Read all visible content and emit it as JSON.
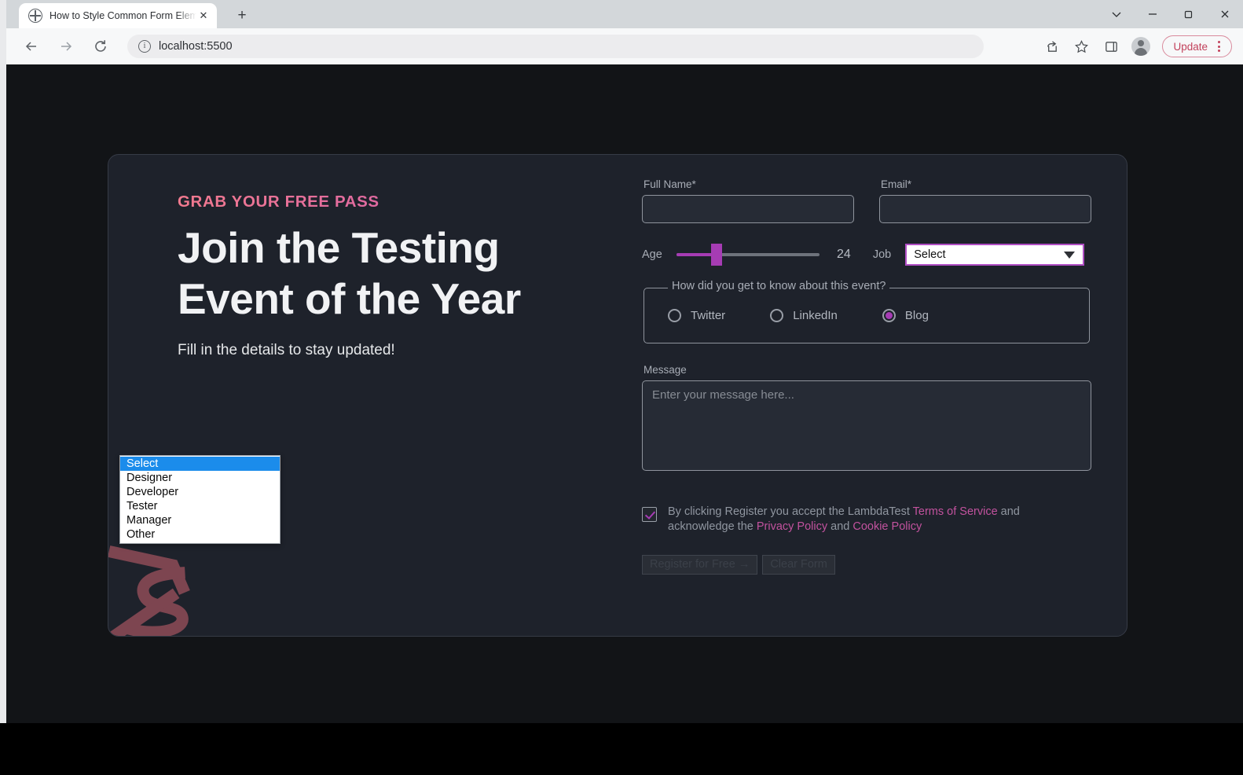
{
  "browser": {
    "tab": {
      "title": "How to Style Common Form Elem",
      "favicon": "globe-icon",
      "close_label": "✕"
    },
    "new_tab_label": "+",
    "window_controls": {
      "chevron": "chevron-down-icon",
      "minimize": "minimize-icon",
      "maximize": "maximize-icon",
      "close": "close-icon"
    },
    "toolbar": {
      "back": "back-arrow-icon",
      "forward": "forward-arrow-icon",
      "reload": "reload-icon",
      "site_info": "info-icon",
      "url": "localhost:5500",
      "share": "share-icon",
      "bookmark": "star-icon",
      "side_panel": "side-panel-icon",
      "profile": "avatar-icon",
      "update_label": "Update",
      "menu": "kebab-menu-icon"
    }
  },
  "page": {
    "promo": {
      "eyebrow": "GRAB YOUR FREE PASS",
      "title_line1": "Join the Testing",
      "title_line2": "Event of the Year",
      "subtitle": "Fill in the details to stay updated!"
    },
    "form": {
      "full_name": {
        "label": "Full Name*",
        "value": "",
        "placeholder": ""
      },
      "email": {
        "label": "Email*",
        "value": "",
        "placeholder": ""
      },
      "age": {
        "label": "Age",
        "value": "24",
        "min": "0",
        "max": "100"
      },
      "job": {
        "label": "Job",
        "selected": "Select",
        "arrow": "dropdown-arrow-icon",
        "options": [
          "Select",
          "Designer",
          "Developer",
          "Tester",
          "Manager",
          "Other"
        ],
        "highlighted": "Select"
      },
      "source": {
        "legend": "How did you get to know about this event?",
        "options": [
          {
            "label": "Twitter",
            "checked": false
          },
          {
            "label": "LinkedIn",
            "checked": false
          },
          {
            "label": "Blog",
            "checked": true
          }
        ]
      },
      "message": {
        "label": "Message",
        "value": "",
        "placeholder": "Enter your message here..."
      },
      "terms": {
        "checked": true,
        "text_part1": "By clicking Register you accept the LambdaTest ",
        "link_tos": "Terms of Service",
        "text_part2": " and acknowledge the ",
        "link_privacy": "Privacy Policy",
        "text_part3": " and ",
        "link_cookie": "Cookie Policy"
      },
      "buttons": {
        "submit": "Register for Free →",
        "clear": "Clear Form"
      }
    }
  },
  "colors": {
    "page_bg": "#121417",
    "card_bg": "#1e222b",
    "accent_purple": "#a63cb4",
    "accent_pink": "#c2529e",
    "input_border": "#8f949d",
    "highlight_blue": "#1b8ceb",
    "update_red": "#c2415b"
  }
}
